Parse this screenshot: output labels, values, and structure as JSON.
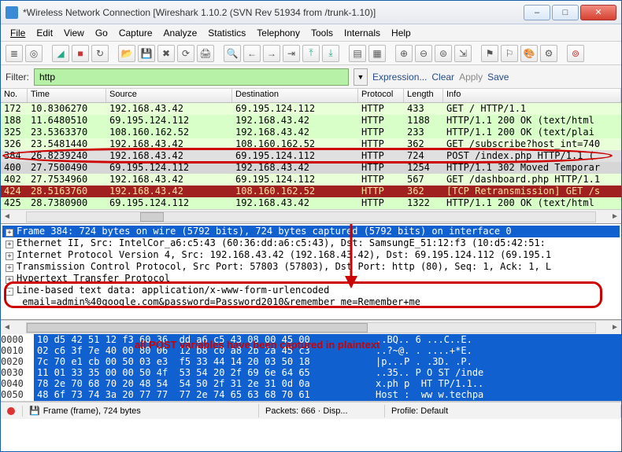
{
  "window": {
    "title": "*Wireless Network Connection   [Wireshark 1.10.2  (SVN Rev 51934 from /trunk-1.10)]"
  },
  "menu": [
    "File",
    "Edit",
    "View",
    "Go",
    "Capture",
    "Analyze",
    "Statistics",
    "Telephony",
    "Tools",
    "Internals",
    "Help"
  ],
  "filter": {
    "label": "Filter:",
    "value": "http",
    "links": {
      "expression": "Expression...",
      "clear": "Clear",
      "apply": "Apply",
      "save": "Save"
    }
  },
  "columns": {
    "no": "No.",
    "time": "Time",
    "src": "Source",
    "dst": "Destination",
    "proto": "Protocol",
    "len": "Length",
    "info": "Info"
  },
  "packets": [
    {
      "no": "172",
      "time": "10.8306270",
      "src": "192.168.43.42",
      "dst": "69.195.124.112",
      "proto": "HTTP",
      "len": "433",
      "info": "GET / HTTP/1.1",
      "cls": "lgreen"
    },
    {
      "no": "188",
      "time": "11.6480510",
      "src": "69.195.124.112",
      "dst": "192.168.43.42",
      "proto": "HTTP",
      "len": "1188",
      "info": "HTTP/1.1 200 OK  (text/html",
      "cls": "green"
    },
    {
      "no": "325",
      "time": "23.5363370",
      "src": "108.160.162.52",
      "dst": "192.168.43.42",
      "proto": "HTTP",
      "len": "233",
      "info": "HTTP/1.1 200 OK  (text/plai",
      "cls": "green"
    },
    {
      "no": "326",
      "time": "23.5481440",
      "src": "192.168.43.42",
      "dst": "108.160.162.52",
      "proto": "HTTP",
      "len": "362",
      "info": "GET /subscribe?host_int=740",
      "cls": "lgreen"
    },
    {
      "no": "384",
      "time": "26.8239240",
      "src": "192.168.43.42",
      "dst": "69.195.124.112",
      "proto": "HTTP",
      "len": "724",
      "info": "POST /index.php HTTP/1.1  (",
      "cls": "sel"
    },
    {
      "no": "400",
      "time": "27.7500490",
      "src": "69.195.124.112",
      "dst": "192.168.43.42",
      "proto": "HTTP",
      "len": "1254",
      "info": "HTTP/1.1 302 Moved Temporar",
      "cls": "gray"
    },
    {
      "no": "402",
      "time": "27.7534960",
      "src": "192.168.43.42",
      "dst": "69.195.124.112",
      "proto": "HTTP",
      "len": "567",
      "info": "GET /dashboard.php HTTP/1.1",
      "cls": "lgreen"
    },
    {
      "no": "424",
      "time": "28.5163760",
      "src": "192.168.43.42",
      "dst": "108.160.162.52",
      "proto": "HTTP",
      "len": "362",
      "info": "[TCP Retransmission] GET /s",
      "cls": "red"
    },
    {
      "no": "425",
      "time": "28.7380900",
      "src": "69.195.124.112",
      "dst": "192.168.43.42",
      "proto": "HTTP",
      "len": "1322",
      "info": "HTTP/1.1 200 OK  (text/html",
      "cls": "green"
    }
  ],
  "details": [
    {
      "t": "Frame 384: 724 bytes on wire (5792 bits), 724 bytes captured (5792 bits) on interface 0",
      "box": "+",
      "sel": true
    },
    {
      "t": "Ethernet II, Src: IntelCor_a6:c5:43 (60:36:dd:a6:c5:43), Dst: SamsungE_51:12:f3 (10:d5:42:51:",
      "box": "+"
    },
    {
      "t": "Internet Protocol Version 4, Src: 192.168.43.42 (192.168.43.42), Dst: 69.195.124.112 (69.195.1",
      "box": "+"
    },
    {
      "t": "Transmission Control Protocol, Src Port: 57803 (57803), Dst Port: http (80), Seq: 1, Ack: 1, L",
      "box": "+"
    },
    {
      "t": "Hypertext Transfer Protocol",
      "box": "+"
    },
    {
      "t": "Line-based text data: application/x-www-form-urlencoded",
      "box": "-"
    },
    {
      "t": "    email=admin%40google.com&password=Password2010&remember_me=Remember+me",
      "box": ""
    }
  ],
  "annotation": "all POST variables have been captured in plaintext",
  "hex": {
    "offsets": [
      "0000",
      "0010",
      "0020",
      "0030",
      "0040",
      "0050"
    ],
    "bytes": [
      "10 d5 42 51 12 f3 60 36  dd a6 c5 43 08 00 45 00",
      "02 c6 3f 7e 40 00 80 06  12 b8 c0 a8 2b 2a 45 c3",
      "7c 70 e1 cb 00 50 03 e3  f5 33 44 14 20 03 50 18",
      "11 01 33 35 00 00 50 4f  53 54 20 2f 69 6e 64 65",
      "78 2e 70 68 70 20 48 54  54 50 2f 31 2e 31 0d 0a",
      "48 6f 73 74 3a 20 77 77  77 2e 74 65 63 68 70 61"
    ],
    "ascii": [
      "..BQ.. 6 ...C..E.",
      "..?~@. . ....+*E.",
      "|p...P . .3D. .P.",
      "..35.. P O ST /inde",
      "x.ph p  HT TP/1.1..",
      "Host :  ww w.techpa"
    ]
  },
  "status": {
    "frame": "Frame (frame), 724 bytes",
    "packets": "Packets: 666 · Disp...",
    "profile": "Profile: Default"
  }
}
